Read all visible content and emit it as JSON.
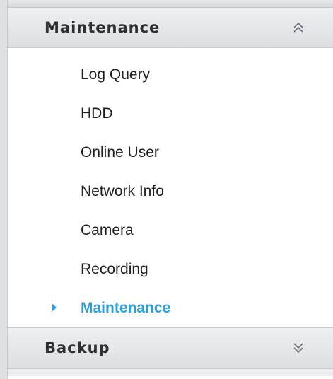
{
  "maintenance_section": {
    "title": "Maintenance",
    "expanded": true,
    "toggle_icon": "double-chevron-up-icon",
    "items": [
      {
        "label": "Log Query",
        "active": false
      },
      {
        "label": "HDD",
        "active": false
      },
      {
        "label": "Online User",
        "active": false
      },
      {
        "label": "Network Info",
        "active": false
      },
      {
        "label": "Camera",
        "active": false
      },
      {
        "label": "Recording",
        "active": false
      },
      {
        "label": "Maintenance",
        "active": true
      }
    ]
  },
  "backup_section": {
    "title": "Backup",
    "expanded": false,
    "toggle_icon": "double-chevron-down-icon"
  },
  "colors": {
    "active_text": "#2d9fd8",
    "header_text": "#2e3034",
    "item_text": "#1e1f22"
  }
}
